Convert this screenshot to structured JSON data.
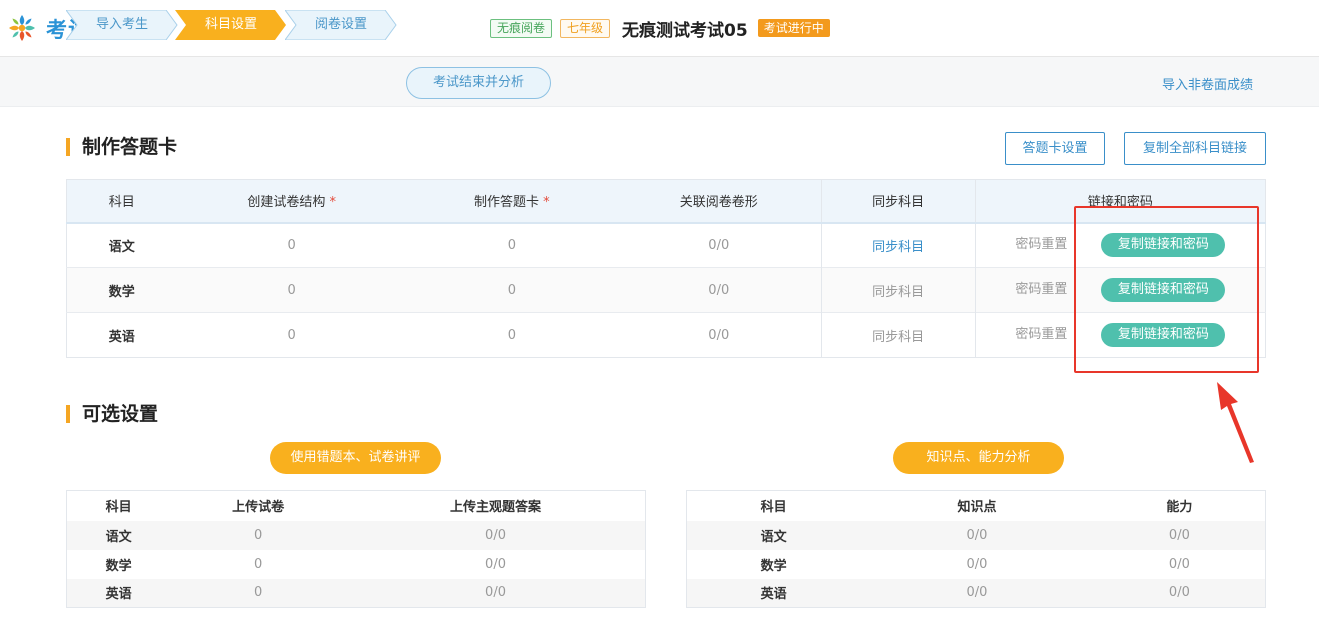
{
  "header": {
    "app_name": "考试系统",
    "tag_mode": "无痕阅卷",
    "tag_grade": "七年级",
    "exam_title": "无痕测试考试05",
    "exam_status": "考试进行中"
  },
  "steps": {
    "items": [
      {
        "label": "导入考生",
        "active": false
      },
      {
        "label": "科目设置",
        "active": true
      },
      {
        "label": "阅卷设置",
        "active": false
      }
    ],
    "end_button": "考试结束并分析",
    "import_link": "导入非卷面成绩"
  },
  "answer_card": {
    "title": "制作答题卡",
    "settings_button": "答题卡设置",
    "copy_all_button": "复制全部科目链接",
    "columns": [
      "科目",
      "创建试卷结构",
      "制作答题卡",
      "关联阅卷卷形",
      "同步科目",
      "链接和密码"
    ],
    "required_mark": "*",
    "rows": [
      {
        "subject": "语文",
        "structure": "0",
        "card": "0",
        "link": "0/0",
        "sync": "同步科目",
        "reset": "密码重置",
        "copy": "复制链接和密码"
      },
      {
        "subject": "数学",
        "structure": "0",
        "card": "0",
        "link": "0/0",
        "sync": "同步科目",
        "reset": "密码重置",
        "copy": "复制链接和密码"
      },
      {
        "subject": "英语",
        "structure": "0",
        "card": "0",
        "link": "0/0",
        "sync": "同步科目",
        "reset": "密码重置",
        "copy": "复制链接和密码"
      }
    ]
  },
  "optional": {
    "title": "可选设置",
    "left_button": "使用错题本、试卷讲评",
    "right_button": "知识点、能力分析",
    "left_table": {
      "columns": [
        "科目",
        "上传试卷",
        "上传主观题答案"
      ],
      "rows": [
        [
          "语文",
          "0",
          "0/0"
        ],
        [
          "数学",
          "0",
          "0/0"
        ],
        [
          "英语",
          "0",
          "0/0"
        ]
      ]
    },
    "right_table": {
      "columns": [
        "科目",
        "知识点",
        "能力"
      ],
      "rows": [
        [
          "语文",
          "0/0",
          "0/0"
        ],
        [
          "数学",
          "0/0",
          "0/0"
        ],
        [
          "英语",
          "0/0",
          "0/0"
        ]
      ]
    }
  },
  "colors": {
    "primary": "#3a8fc9",
    "accent_orange": "#f5a623",
    "copy_green": "#4fc0ad",
    "annotation_red": "#e8362a"
  }
}
